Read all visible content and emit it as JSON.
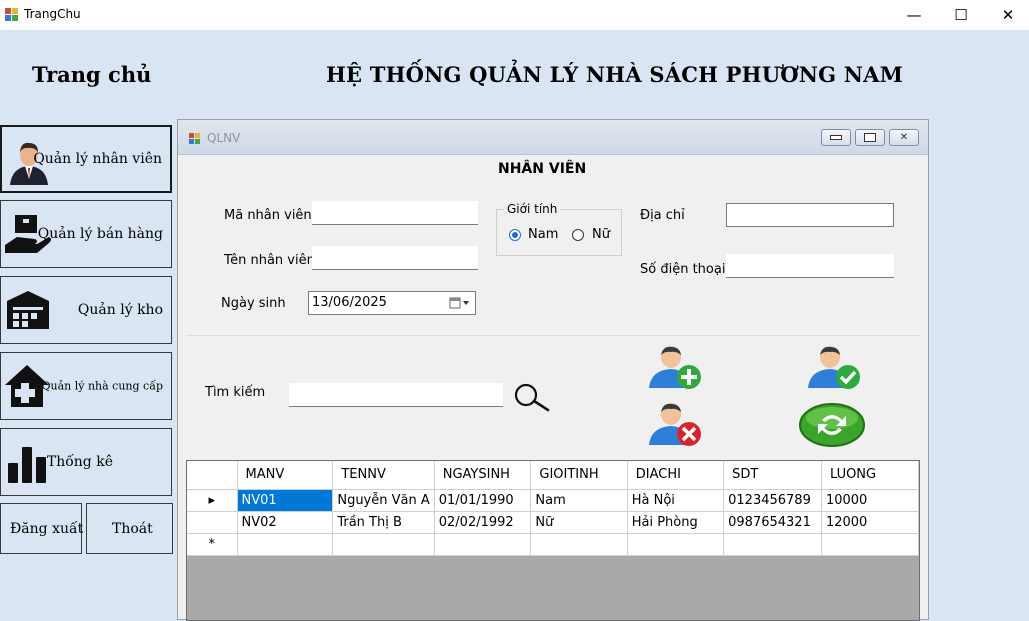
{
  "window": {
    "title": "TrangChu",
    "controls": {
      "minimize": "—",
      "maximize": "☐",
      "close": "✕"
    }
  },
  "header": {
    "home": "Trang chủ",
    "system_title": "HỆ THỐNG QUẢN LÝ NHÀ SÁCH PHƯƠNG NAM"
  },
  "menu": {
    "employees": "Quản lý nhân viên",
    "sales": "Quản lý bán hàng",
    "warehouse": "Quản lý kho",
    "suppliers": "Quản lý nhà cung cấp",
    "stats": "Thống kê",
    "logout": "Đăng xuất",
    "exit": "Thoát"
  },
  "form": {
    "title": "QLNV",
    "heading": "NHÂN VIÊN",
    "labels": {
      "id": "Mã nhân viên",
      "name": "Tên nhân viên",
      "dob": "Ngày sinh",
      "gender": "Giới tính",
      "male": "Nam",
      "female": "Nữ",
      "address": "Địa chỉ",
      "phone": "Số điện thoại",
      "search": "Tìm kiếm"
    },
    "values": {
      "id": "",
      "name": "",
      "dob": "13/06/2025",
      "address": "",
      "phone": "",
      "search": ""
    },
    "gender_selected": "Nam"
  },
  "grid": {
    "columns": [
      "MANV",
      "TENNV",
      "NGAYSINH",
      "GIOITINH",
      "DIACHI",
      "SDT",
      "LUONG"
    ],
    "rows": [
      [
        "NV01",
        "Nguyễn Văn A",
        "01/01/1990",
        "Nam",
        "Hà Nội",
        "0123456789",
        "10000"
      ],
      [
        "NV02",
        "Trần Thị B",
        "02/02/1992",
        "Nữ",
        "Hải Phòng",
        "0987654321",
        "12000"
      ]
    ],
    "current_row_marker": "▸",
    "new_row_marker": "*"
  },
  "icons": {
    "add": "add-user-icon",
    "edit": "confirm-user-icon",
    "delete": "delete-user-icon",
    "refresh": "refresh-icon",
    "search": "search-icon"
  },
  "colors": {
    "background": "#d9e5f3",
    "accent": "#1b6fd4",
    "selection": "#0078d7",
    "add_green": "#2eaa3d",
    "delete_red": "#d7262b"
  }
}
